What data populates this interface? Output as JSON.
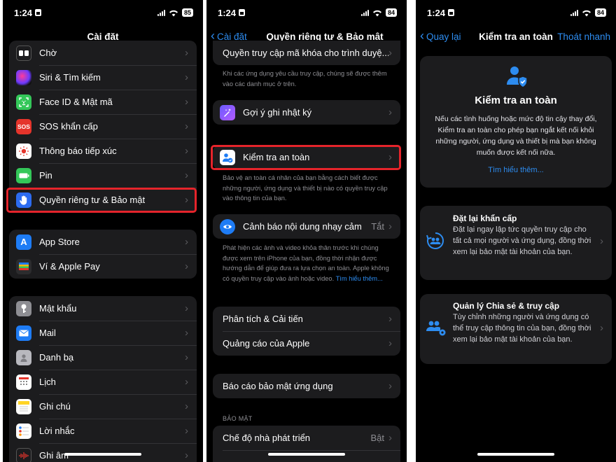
{
  "status": {
    "p1": {
      "time": "1:24",
      "battery": "85"
    },
    "p2": {
      "time": "1:24",
      "battery": "84"
    },
    "p3": {
      "time": "1:24",
      "battery": "84"
    }
  },
  "screen1": {
    "title": "Cài đặt",
    "group1": [
      {
        "label": "Chờ",
        "icon": "standby-icon",
        "color": "#1c1c1e"
      },
      {
        "label": "Siri & Tìm kiếm",
        "icon": "siri-icon",
        "color": "#2b2b6e"
      },
      {
        "label": "Face ID & Mật mã",
        "icon": "faceid-icon",
        "color": "#34c759"
      },
      {
        "label": "SOS khẩn cấp",
        "icon": "sos-icon",
        "color": "#e5342b",
        "glyph": "SOS"
      },
      {
        "label": "Thông báo tiếp xúc",
        "icon": "exposure-icon",
        "color": "#ffffff"
      },
      {
        "label": "Pin",
        "icon": "battery-icon",
        "color": "#34c759"
      },
      {
        "label": "Quyền riêng tư & Bảo mật",
        "icon": "privacy-hand-icon",
        "color": "#2d6cf0"
      }
    ],
    "group2": [
      {
        "label": "App Store",
        "icon": "appstore-icon",
        "color": "#1e7cf5",
        "glyph": "A"
      },
      {
        "label": "Ví & Apple Pay",
        "icon": "wallet-icon",
        "color": "#2c2c2e"
      }
    ],
    "group3": [
      {
        "label": "Mật khẩu",
        "icon": "key-icon",
        "color": "#8e8e93"
      },
      {
        "label": "Mail",
        "icon": "mail-icon",
        "color": "#1e7cf5"
      },
      {
        "label": "Danh bạ",
        "icon": "contacts-icon",
        "color": "#b8b8be"
      },
      {
        "label": "Lịch",
        "icon": "calendar-icon",
        "color": "#ffffff"
      },
      {
        "label": "Ghi chú",
        "icon": "notes-icon",
        "color": "#ffd426"
      },
      {
        "label": "Lời nhắc",
        "icon": "reminders-icon",
        "color": "#ffffff"
      },
      {
        "label": "Ghi âm",
        "icon": "voice-memos-icon",
        "color": "#1c1c1e"
      }
    ]
  },
  "screen2": {
    "back": "Cài đặt",
    "title": "Quyền riêng tư & Bảo mật",
    "top_row": "Quyền truy cập mã khóa cho trình duyệ...",
    "top_foot": "Khi các ứng dụng yêu cầu truy cập, chúng sẽ được thêm vào các danh mục ở trên.",
    "journal": "Gợi ý ghi nhật ký",
    "safety": "Kiểm tra an toàn",
    "safety_foot": "Bảo vệ an toàn cá nhân của bạn bằng cách biết được những người, ứng dụng và thiết bị nào có quyền truy cập vào thông tin của bạn.",
    "sensitive": "Cảnh báo nội dung nhạy cảm",
    "sensitive_val": "Tắt",
    "sensitive_foot": "Phát hiện các ảnh và video khỏa thân trước khi chúng được xem trên iPhone của bạn, đồng thời nhận được hướng dẫn để giúp đưa ra lựa chọn an toàn. Apple không có quyền truy cập vào ảnh hoặc video.",
    "sensitive_link": "Tìm hiểu thêm...",
    "analytics": "Phân tích & Cải tiến",
    "ads": "Quảng cáo của Apple",
    "app_report": "Báo cáo bảo mật ứng dụng",
    "security_header": "BẢO MẬT",
    "dev_mode": "Chế độ nhà phát triển",
    "dev_mode_val": "Bật"
  },
  "screen3": {
    "back": "Quay lại",
    "title": "Kiểm tra an toàn",
    "quick_exit": "Thoát nhanh",
    "hero_title": "Kiểm tra an toàn",
    "hero_desc": "Nếu các tình huống hoặc mức độ tin cậy thay đổi, Kiểm tra an toàn cho phép bạn ngắt kết nối khỏi những người, ứng dụng và thiết bị mà bạn không muốn được kết nối nữa.",
    "hero_link": "Tìm hiểu thêm...",
    "reset_title": "Đặt lại khẩn cấp",
    "reset_desc": "Đặt lại ngay lập tức quyền truy cập cho tất cả mọi người và ứng dụng, đồng thời xem lại bảo mật tài khoản của bạn.",
    "manage_title": "Quản lý Chia sẻ & truy cập",
    "manage_desc": "Tùy chỉnh những người và ứng dụng có thể truy cập thông tin của bạn, đồng thời xem lại bảo mật tài khoản của bạn."
  },
  "colors": {
    "accent": "#2d8cf0",
    "highlight": "#e5242b",
    "cell": "#1c1c1e"
  }
}
